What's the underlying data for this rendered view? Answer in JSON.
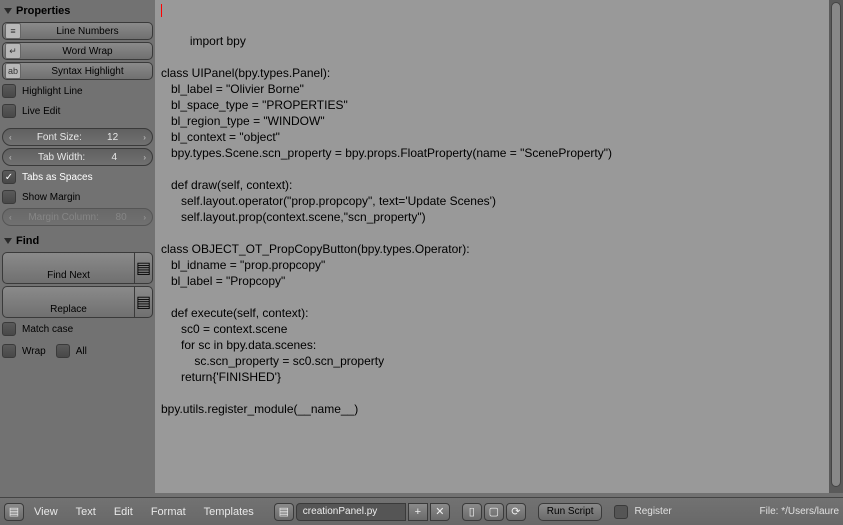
{
  "sidebar": {
    "properties": {
      "title": "Properties",
      "line_numbers": "Line Numbers",
      "word_wrap": "Word Wrap",
      "syntax_highlight": "Syntax Highlight",
      "highlight_line": "Highlight Line",
      "live_edit": "Live Edit",
      "font_size_label": "Font Size:",
      "font_size_value": "12",
      "tab_width_label": "Tab Width:",
      "tab_width_value": "4",
      "tabs_as_spaces": "Tabs as Spaces",
      "show_margin": "Show Margin",
      "margin_column_label": "Margin Column:",
      "margin_column_value": "80"
    },
    "find": {
      "title": "Find",
      "find_next": "Find Next",
      "replace": "Replace",
      "match_case": "Match case",
      "wrap": "Wrap",
      "all": "All"
    }
  },
  "editor": {
    "code": "import bpy\n\nclass UIPanel(bpy.types.Panel):\n   bl_label = \"Olivier Borne\"\n   bl_space_type = \"PROPERTIES\"\n   bl_region_type = \"WINDOW\"\n   bl_context = \"object\"\n   bpy.types.Scene.scn_property = bpy.props.FloatProperty(name = \"SceneProperty\")\n\n   def draw(self, context):\n      self.layout.operator(\"prop.propcopy\", text='Update Scenes')\n      self.layout.prop(context.scene,\"scn_property\")\n\nclass OBJECT_OT_PropCopyButton(bpy.types.Operator):\n   bl_idname = \"prop.propcopy\"\n   bl_label = \"Propcopy\"\n\n   def execute(self, context):\n      sc0 = context.scene\n      for sc in bpy.data.scenes:\n          sc.scn_property = sc0.scn_property\n      return{'FINISHED'}\n\nbpy.utils.register_module(__name__)"
  },
  "footer": {
    "menus": [
      "View",
      "Text",
      "Edit",
      "Format",
      "Templates"
    ],
    "filename": "creationPanel.py",
    "run_script": "Run Script",
    "register": "Register",
    "file_path": "File: */Users/laure"
  }
}
